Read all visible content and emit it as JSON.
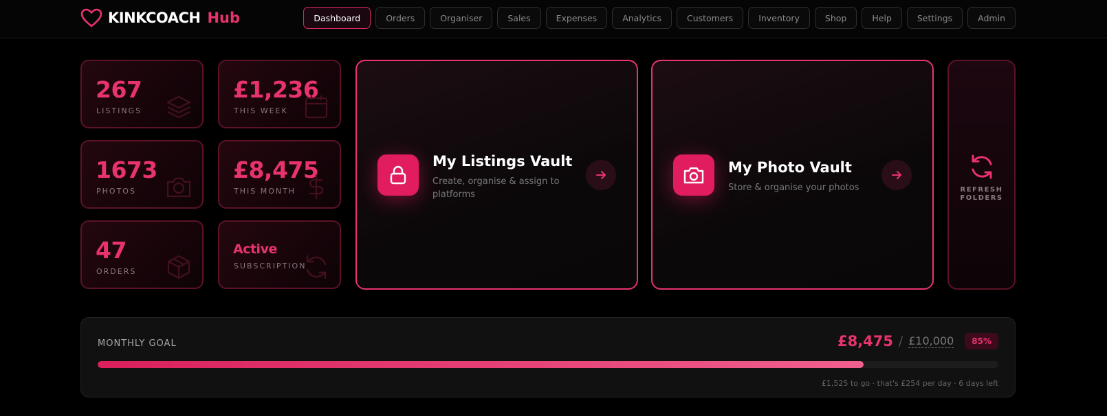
{
  "brand": {
    "name": "KINKCOACH",
    "accent": "Hub",
    "color": "#e8336d"
  },
  "nav": [
    {
      "label": "Dashboard",
      "active": true
    },
    {
      "label": "Orders"
    },
    {
      "label": "Organiser"
    },
    {
      "label": "Sales"
    },
    {
      "label": "Expenses"
    },
    {
      "label": "Analytics"
    },
    {
      "label": "Customers"
    },
    {
      "label": "Inventory"
    },
    {
      "label": "Shop"
    },
    {
      "label": "Help"
    },
    {
      "label": "Settings"
    },
    {
      "label": "Admin"
    }
  ],
  "stats": {
    "listings": {
      "value": "267",
      "label": "LISTINGS",
      "icon": "layers-icon"
    },
    "this_week": {
      "value": "£1,236",
      "label": "THIS WEEK",
      "icon": "calendar-icon"
    },
    "photos": {
      "value": "1673",
      "label": "PHOTOS",
      "icon": "camera-icon"
    },
    "this_month": {
      "value": "£8,475",
      "label": "THIS MONTH",
      "icon": "dollar-icon"
    },
    "orders": {
      "value": "47",
      "label": "ORDERS",
      "icon": "box-icon"
    },
    "subscription": {
      "value": "Active",
      "label": "SUBSCRIPTION",
      "icon": "refresh-icon"
    }
  },
  "vaults": {
    "listings": {
      "title": "My Listings Vault",
      "description": "Create, organise & assign to platforms",
      "icon": "lock-icon"
    },
    "photos": {
      "title": "My Photo Vault",
      "description": "Store & organise your photos",
      "icon": "camera-icon"
    }
  },
  "refresh": {
    "label_line1": "REFRESH",
    "label_line2": "FOLDERS",
    "icon": "refresh-icon"
  },
  "goal": {
    "title": "MONTHLY GOAL",
    "current": "£8,475",
    "separator": "/",
    "target": "£10,000",
    "percent_label": "85%",
    "progress": 0.85,
    "note": "£1,525 to go · that's £254 per day · 6 days left"
  }
}
